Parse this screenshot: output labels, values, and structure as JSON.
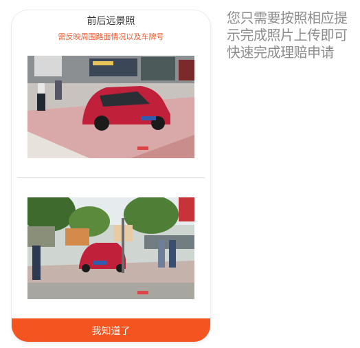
{
  "dialog": {
    "title": "前后远景照",
    "subtitle": "需反映周围路面情况以及车牌号",
    "photos": [
      {
        "icon": "car-front-street-photo"
      },
      {
        "icon": "car-parking-lot-photo"
      }
    ],
    "confirm_label": "我知道了"
  },
  "hint": {
    "text": "您只需要按照相应提示完成照片上传即可快速完成理赔申请"
  },
  "colors": {
    "accent": "#f4541f",
    "subtitle": "#f0592a",
    "hint_text": "#8c8c8c",
    "car": "#c0203a"
  }
}
